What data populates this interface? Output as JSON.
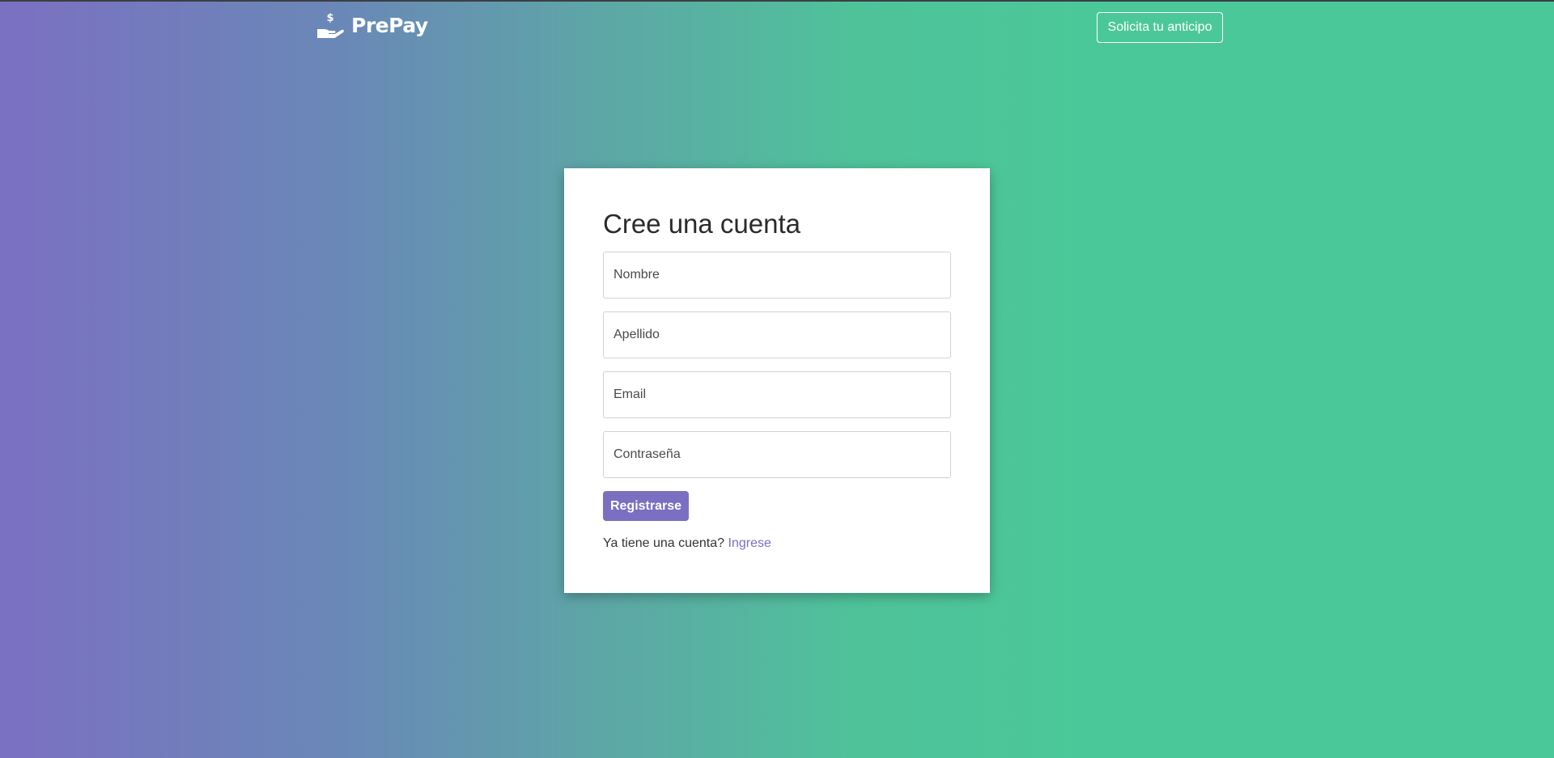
{
  "header": {
    "brand_name": "PrePay",
    "brand_icon": "hand-dollar-icon",
    "cta_label": "Solicita tu anticipo"
  },
  "form": {
    "title": "Cree una cuenta",
    "fields": {
      "first_name_placeholder": "Nombre",
      "last_name_placeholder": "Apellido",
      "email_placeholder": "Email",
      "password_placeholder": "Contraseña"
    },
    "submit_label": "Registrarse",
    "login_prompt": "Ya tiene una cuenta?",
    "login_link_label": "Ingrese"
  },
  "colors": {
    "gradient_start": "#7b70c2",
    "gradient_end": "#4bc899",
    "accent": "#7b6fc1",
    "card_bg": "#ffffff"
  }
}
